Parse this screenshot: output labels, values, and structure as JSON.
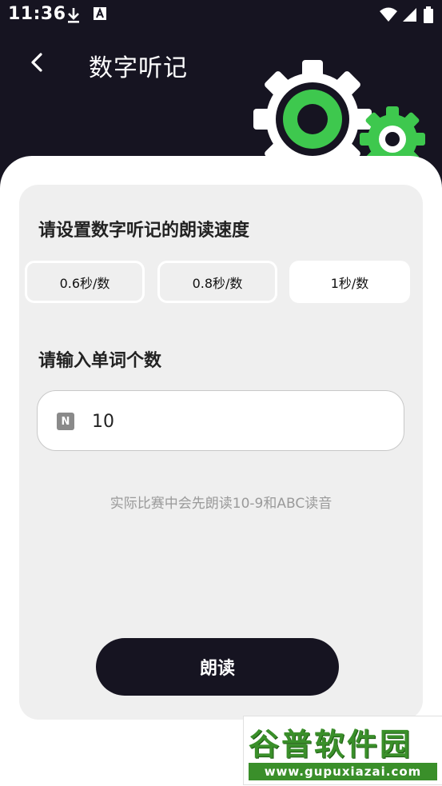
{
  "status_bar": {
    "time": "11:36",
    "icons": [
      "download-icon",
      "font-a-icon",
      "wifi-icon",
      "signal-icon",
      "battery-icon"
    ]
  },
  "header": {
    "title": "数字听记",
    "back_icon": "chevron-left-icon",
    "background_color": "#161421",
    "accent_color": "#3ec84e"
  },
  "speed_section": {
    "label": "请设置数字听记的朗读速度",
    "options": [
      "0.6秒/数",
      "0.8秒/数",
      "1秒/数"
    ],
    "selected_index": 2
  },
  "count_section": {
    "label": "请输入单词个数",
    "input_icon": "N",
    "input_value": "10"
  },
  "hint": "实际比赛中会先朗读10-9和ABC读音",
  "read_button": {
    "label": "朗读"
  },
  "watermark": {
    "title": "谷普软件园",
    "url": "www.gupuxiazai.com"
  }
}
